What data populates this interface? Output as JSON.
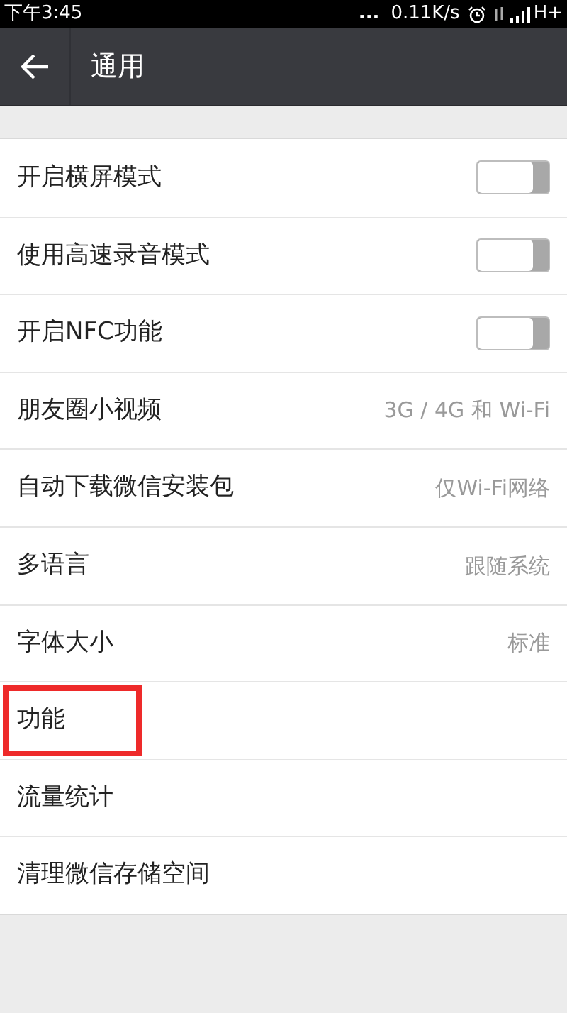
{
  "status_bar": {
    "time": "下午3:45",
    "dots": "...",
    "speed": "0.11K/s",
    "network": "H+"
  },
  "app_bar": {
    "title": "通用"
  },
  "settings": [
    {
      "kind": "toggle",
      "label": "开启横屏模式",
      "on": false,
      "highlighted": false
    },
    {
      "kind": "toggle",
      "label": "使用高速录音模式",
      "on": false,
      "highlighted": false
    },
    {
      "kind": "toggle",
      "label": "开启NFC功能",
      "on": false,
      "highlighted": false
    },
    {
      "kind": "value",
      "label": "朋友圈小视频",
      "value": "3G / 4G 和 Wi-Fi",
      "highlighted": false
    },
    {
      "kind": "value",
      "label": "自动下载微信安装包",
      "value": "仅Wi-Fi网络",
      "highlighted": false
    },
    {
      "kind": "value",
      "label": "多语言",
      "value": "跟随系统",
      "highlighted": false
    },
    {
      "kind": "value",
      "label": "字体大小",
      "value": "标准",
      "highlighted": false
    },
    {
      "kind": "link",
      "label": "功能",
      "highlighted": true
    },
    {
      "kind": "link",
      "label": "流量统计",
      "highlighted": false
    },
    {
      "kind": "link",
      "label": "清理微信存储空间",
      "highlighted": false
    }
  ]
}
